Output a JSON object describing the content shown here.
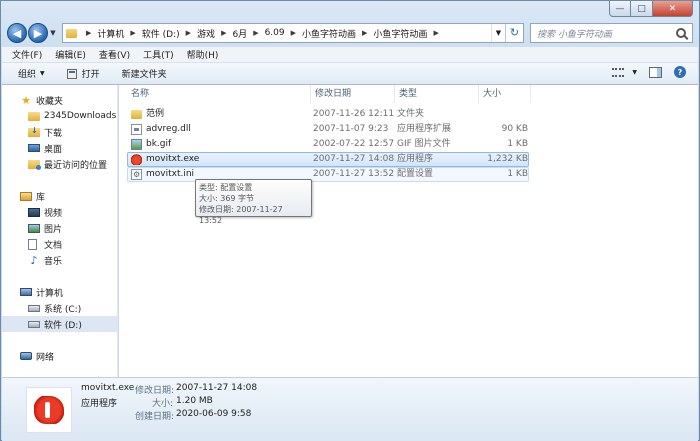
{
  "window": {
    "caption": {
      "minimize": "—",
      "maximize": "□",
      "close": "✕"
    }
  },
  "address": {
    "back": "◀",
    "forward": "▶",
    "crumbs": [
      "计算机",
      "软件 (D:)",
      "游戏",
      "6月",
      "6.09",
      "小鱼字符动画",
      "小鱼字符动画"
    ],
    "refresh": "↻"
  },
  "search": {
    "placeholder": "搜索 小鱼字符动画"
  },
  "menu": [
    "文件(F)",
    "编辑(E)",
    "查看(V)",
    "工具(T)",
    "帮助(H)"
  ],
  "commands": {
    "organize": "组织",
    "open": "打开",
    "new_folder": "新建文件夹",
    "help": "?"
  },
  "nav": {
    "favorites": "收藏夹",
    "favorites_items": [
      "2345Downloads",
      "下载",
      "桌面",
      "最近访问的位置"
    ],
    "libraries": "库",
    "libraries_items": [
      "视频",
      "图片",
      "文档",
      "音乐"
    ],
    "computer": "计算机",
    "computer_items": [
      "系统 (C:)",
      "软件 (D:)"
    ],
    "network": "网络"
  },
  "columns": {
    "name": "名称",
    "date": "修改日期",
    "type": "类型",
    "size": "大小"
  },
  "files": [
    {
      "name": "范例",
      "date": "2007-11-26 12:11",
      "type": "文件夹",
      "size": "",
      "icon": "folder-icon"
    },
    {
      "name": "advreg.dll",
      "date": "2007-11-07 9:23",
      "type": "应用程序扩展",
      "size": "90 KB",
      "icon": "dll-file-icon"
    },
    {
      "name": "bk.gif",
      "date": "2002-07-22 12:57",
      "type": "GIF 图片文件",
      "size": "1 KB",
      "icon": "gif-file-icon"
    },
    {
      "name": "movitxt.exe",
      "date": "2007-11-27 14:08",
      "type": "应用程序",
      "size": "1,232 KB",
      "icon": "exe-app-icon"
    },
    {
      "name": "movitxt.ini",
      "date": "2007-11-27 13:52",
      "type": "配置设置",
      "size": "1 KB",
      "icon": "ini-file-icon"
    }
  ],
  "tooltip": {
    "type": "类型: 配置设置",
    "size": "大小: 369 字节",
    "modified": "修改日期: 2007-11-27 13:52"
  },
  "details": {
    "filename": "movitxt.exe",
    "filetype": "应用程序",
    "modified_label": "修改日期:",
    "modified_value": "2007-11-27 14:08",
    "size_label": "大小:",
    "size_value": "1.20 MB",
    "created_label": "创建日期:",
    "created_value": "2020-06-09 9:58"
  },
  "colors": {
    "selection": "#d3e5fa",
    "selection_border": "#8fb9e8",
    "close_button": "#c3422f"
  }
}
